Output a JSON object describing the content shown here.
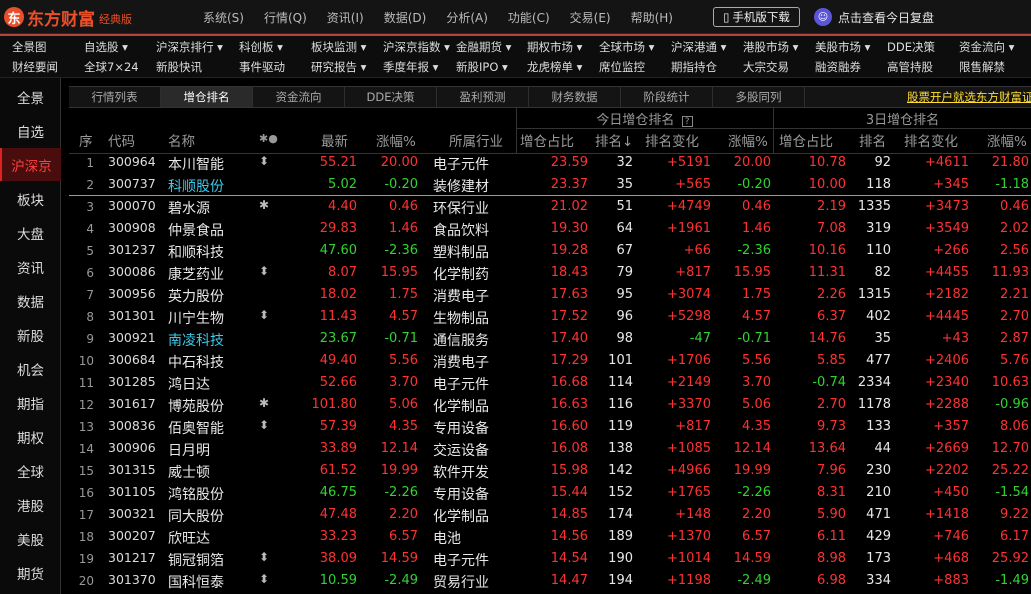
{
  "app": {
    "logo_mark": "东",
    "brand": "东方财富",
    "edition": "经典版",
    "menu": [
      "系统(S)",
      "行情(Q)",
      "资讯(I)",
      "数据(D)",
      "分析(A)",
      "功能(C)",
      "交易(E)",
      "帮助(H)"
    ],
    "mobile_button": "手机版下载",
    "review_link": "点击查看今日复盘"
  },
  "quick_menu": {
    "row1": [
      "全景图",
      "自选股 ▾",
      "沪深京排行 ▾",
      "科创板 ▾",
      "板块监测 ▾",
      "沪深京指数 ▾",
      "金融期货 ▾",
      "期权市场 ▾",
      "全球市场 ▾",
      "沪深港通 ▾",
      "港股市场 ▾",
      "美股市场 ▾",
      "DDE决策",
      "资金流向 ▾"
    ],
    "row2": [
      "财经要闻",
      "全球7×24",
      "新股快讯",
      "事件驱动",
      "研究报告 ▾",
      "季度年报 ▾",
      "新股IPO ▾",
      "龙虎榜单 ▾",
      "席位监控",
      "期指持仓",
      "大宗交易",
      "融资融券",
      "高管持股",
      "限售解禁"
    ]
  },
  "sidebar": [
    "全景",
    "自选",
    "沪深京",
    "板块",
    "大盘",
    "资讯",
    "数据",
    "新股",
    "机会",
    "期指",
    "期权",
    "全球",
    "港股",
    "美股",
    "期货"
  ],
  "sidebar_active": 2,
  "subtabs": [
    "行情列表",
    "增仓排名",
    "资金流向",
    "DDE决策",
    "盈利预测",
    "财务数据",
    "阶段统计",
    "多股同列"
  ],
  "subtab_active": 1,
  "promo": "股票开户就选东方财富证券>>",
  "table": {
    "group_today": "今日增仓排名",
    "group_today_icon": "?",
    "group_3day": "3日增仓排名",
    "headers": [
      "序",
      "代码",
      "名称",
      "✱●",
      "最新",
      "涨幅%",
      "所属行业",
      "增仓占比",
      "排名↓",
      "排名变化",
      "涨幅%",
      "增仓占比",
      "排名",
      "排名变化",
      "涨幅%"
    ],
    "rows": [
      {
        "idx": "1",
        "code": "300964",
        "name": "本川智能",
        "name_color": "white",
        "flag": "⬍",
        "price": "55.21",
        "pct": "20.00",
        "dir": "up",
        "industry": "电子元件",
        "t_ratio": "23.59",
        "t_rank": "32",
        "t_chg": "+5191",
        "t_pct": "20.00",
        "d_ratio": "10.78",
        "d_rank": "92",
        "d_chg": "+4611",
        "d_pct": "21.80",
        "d_pct_dir": "up",
        "d_ratio_dir": "up",
        "t_chg_dir": "up",
        "d_chg_dir": "up"
      },
      {
        "idx": "2",
        "code": "300737",
        "name": "科顺股份",
        "name_color": "cyan",
        "flag": "",
        "price": "5.02",
        "pct": "-0.20",
        "dir": "down",
        "industry": "装修建材",
        "t_ratio": "23.37",
        "t_rank": "35",
        "t_chg": "+565",
        "t_pct": "-0.20",
        "d_ratio": "10.00",
        "d_rank": "118",
        "d_chg": "+345",
        "d_pct": "-1.18",
        "d_pct_dir": "down",
        "d_ratio_dir": "up",
        "t_chg_dir": "up",
        "d_chg_dir": "up"
      },
      {
        "idx": "3",
        "code": "300070",
        "name": "碧水源",
        "name_color": "white",
        "flag": "✱",
        "price": "4.40",
        "pct": "0.46",
        "dir": "up",
        "industry": "环保行业",
        "t_ratio": "21.02",
        "t_rank": "51",
        "t_chg": "+4749",
        "t_pct": "0.46",
        "d_ratio": "2.19",
        "d_rank": "1335",
        "d_chg": "+3473",
        "d_pct": "0.46",
        "d_pct_dir": "up",
        "d_ratio_dir": "up",
        "t_chg_dir": "up",
        "d_chg_dir": "up"
      },
      {
        "idx": "4",
        "code": "300908",
        "name": "仲景食品",
        "name_color": "white",
        "flag": "",
        "price": "29.83",
        "pct": "1.46",
        "dir": "up",
        "industry": "食品饮料",
        "t_ratio": "19.30",
        "t_rank": "64",
        "t_chg": "+1961",
        "t_pct": "1.46",
        "d_ratio": "7.08",
        "d_rank": "319",
        "d_chg": "+3549",
        "d_pct": "2.02",
        "d_pct_dir": "up",
        "d_ratio_dir": "up",
        "t_chg_dir": "up",
        "d_chg_dir": "up"
      },
      {
        "idx": "5",
        "code": "301237",
        "name": "和顺科技",
        "name_color": "white",
        "flag": "",
        "price": "47.60",
        "pct": "-2.36",
        "dir": "down",
        "industry": "塑料制品",
        "t_ratio": "19.28",
        "t_rank": "67",
        "t_chg": "+66",
        "t_pct": "-2.36",
        "d_ratio": "10.16",
        "d_rank": "110",
        "d_chg": "+266",
        "d_pct": "2.56",
        "d_pct_dir": "up",
        "d_ratio_dir": "up",
        "t_chg_dir": "up",
        "d_chg_dir": "up"
      },
      {
        "idx": "6",
        "code": "300086",
        "name": "康芝药业",
        "name_color": "white",
        "flag": "⬍",
        "price": "8.07",
        "pct": "15.95",
        "dir": "up",
        "industry": "化学制药",
        "t_ratio": "18.43",
        "t_rank": "79",
        "t_chg": "+817",
        "t_pct": "15.95",
        "d_ratio": "11.31",
        "d_rank": "82",
        "d_chg": "+4455",
        "d_pct": "11.93",
        "d_pct_dir": "up",
        "d_ratio_dir": "up",
        "t_chg_dir": "up",
        "d_chg_dir": "up"
      },
      {
        "idx": "7",
        "code": "300956",
        "name": "英力股份",
        "name_color": "white",
        "flag": "",
        "price": "18.02",
        "pct": "1.75",
        "dir": "up",
        "industry": "消费电子",
        "t_ratio": "17.63",
        "t_rank": "95",
        "t_chg": "+3074",
        "t_pct": "1.75",
        "d_ratio": "2.26",
        "d_rank": "1315",
        "d_chg": "+2182",
        "d_pct": "2.21",
        "d_pct_dir": "up",
        "d_ratio_dir": "up",
        "t_chg_dir": "up",
        "d_chg_dir": "up"
      },
      {
        "idx": "8",
        "code": "301301",
        "name": "川宁生物",
        "name_color": "white",
        "flag": "⬍",
        "price": "11.43",
        "pct": "4.57",
        "dir": "up",
        "industry": "生物制品",
        "t_ratio": "17.52",
        "t_rank": "96",
        "t_chg": "+5298",
        "t_pct": "4.57",
        "d_ratio": "6.37",
        "d_rank": "402",
        "d_chg": "+4445",
        "d_pct": "2.70",
        "d_pct_dir": "up",
        "d_ratio_dir": "up",
        "t_chg_dir": "up",
        "d_chg_dir": "up"
      },
      {
        "idx": "9",
        "code": "300921",
        "name": "南凌科技",
        "name_color": "cyan",
        "flag": "",
        "price": "23.67",
        "pct": "-0.71",
        "dir": "down",
        "industry": "通信服务",
        "t_ratio": "17.40",
        "t_rank": "98",
        "t_chg": "-47",
        "t_pct": "-0.71",
        "d_ratio": "14.76",
        "d_rank": "35",
        "d_chg": "+43",
        "d_pct": "2.87",
        "d_pct_dir": "up",
        "d_ratio_dir": "up",
        "t_chg_dir": "down",
        "d_chg_dir": "up"
      },
      {
        "idx": "10",
        "code": "300684",
        "name": "中石科技",
        "name_color": "white",
        "flag": "",
        "price": "49.40",
        "pct": "5.56",
        "dir": "up",
        "industry": "消费电子",
        "t_ratio": "17.29",
        "t_rank": "101",
        "t_chg": "+1706",
        "t_pct": "5.56",
        "d_ratio": "5.85",
        "d_rank": "477",
        "d_chg": "+2406",
        "d_pct": "5.76",
        "d_pct_dir": "up",
        "d_ratio_dir": "up",
        "t_chg_dir": "up",
        "d_chg_dir": "up"
      },
      {
        "idx": "11",
        "code": "301285",
        "name": "鸿日达",
        "name_color": "white",
        "flag": "",
        "price": "52.66",
        "pct": "3.70",
        "dir": "up",
        "industry": "电子元件",
        "t_ratio": "16.68",
        "t_rank": "114",
        "t_chg": "+2149",
        "t_pct": "3.70",
        "d_ratio": "-0.74",
        "d_rank": "2334",
        "d_chg": "+2340",
        "d_pct": "10.63",
        "d_pct_dir": "up",
        "d_ratio_dir": "down",
        "t_chg_dir": "up",
        "d_chg_dir": "up"
      },
      {
        "idx": "12",
        "code": "301617",
        "name": "博苑股份",
        "name_color": "white",
        "flag": "✱",
        "price": "101.80",
        "pct": "5.06",
        "dir": "up",
        "industry": "化学制品",
        "t_ratio": "16.63",
        "t_rank": "116",
        "t_chg": "+3370",
        "t_pct": "5.06",
        "d_ratio": "2.70",
        "d_rank": "1178",
        "d_chg": "+2288",
        "d_pct": "-0.96",
        "d_pct_dir": "down",
        "d_ratio_dir": "up",
        "t_chg_dir": "up",
        "d_chg_dir": "up"
      },
      {
        "idx": "13",
        "code": "300836",
        "name": "佰奥智能",
        "name_color": "white",
        "flag": "⬍",
        "price": "57.39",
        "pct": "4.35",
        "dir": "up",
        "industry": "专用设备",
        "t_ratio": "16.60",
        "t_rank": "119",
        "t_chg": "+817",
        "t_pct": "4.35",
        "d_ratio": "9.73",
        "d_rank": "133",
        "d_chg": "+357",
        "d_pct": "8.06",
        "d_pct_dir": "up",
        "d_ratio_dir": "up",
        "t_chg_dir": "up",
        "d_chg_dir": "up"
      },
      {
        "idx": "14",
        "code": "300906",
        "name": "日月明",
        "name_color": "white",
        "flag": "",
        "price": "33.89",
        "pct": "12.14",
        "dir": "up",
        "industry": "交运设备",
        "t_ratio": "16.08",
        "t_rank": "138",
        "t_chg": "+1085",
        "t_pct": "12.14",
        "d_ratio": "13.64",
        "d_rank": "44",
        "d_chg": "+2669",
        "d_pct": "12.70",
        "d_pct_dir": "up",
        "d_ratio_dir": "up",
        "t_chg_dir": "up",
        "d_chg_dir": "up"
      },
      {
        "idx": "15",
        "code": "301315",
        "name": "威士顿",
        "name_color": "white",
        "flag": "",
        "price": "61.52",
        "pct": "19.99",
        "dir": "up",
        "industry": "软件开发",
        "t_ratio": "15.98",
        "t_rank": "142",
        "t_chg": "+4966",
        "t_pct": "19.99",
        "d_ratio": "7.96",
        "d_rank": "230",
        "d_chg": "+2202",
        "d_pct": "25.22",
        "d_pct_dir": "up",
        "d_ratio_dir": "up",
        "t_chg_dir": "up",
        "d_chg_dir": "up"
      },
      {
        "idx": "16",
        "code": "301105",
        "name": "鸿铭股份",
        "name_color": "white",
        "flag": "",
        "price": "46.75",
        "pct": "-2.26",
        "dir": "down",
        "industry": "专用设备",
        "t_ratio": "15.44",
        "t_rank": "152",
        "t_chg": "+1765",
        "t_pct": "-2.26",
        "d_ratio": "8.31",
        "d_rank": "210",
        "d_chg": "+450",
        "d_pct": "-1.54",
        "d_pct_dir": "down",
        "d_ratio_dir": "up",
        "t_chg_dir": "up",
        "d_chg_dir": "up"
      },
      {
        "idx": "17",
        "code": "300321",
        "name": "同大股份",
        "name_color": "white",
        "flag": "",
        "price": "47.48",
        "pct": "2.20",
        "dir": "up",
        "industry": "化学制品",
        "t_ratio": "14.85",
        "t_rank": "174",
        "t_chg": "+148",
        "t_pct": "2.20",
        "d_ratio": "5.90",
        "d_rank": "471",
        "d_chg": "+1418",
        "d_pct": "9.22",
        "d_pct_dir": "up",
        "d_ratio_dir": "up",
        "t_chg_dir": "up",
        "d_chg_dir": "up"
      },
      {
        "idx": "18",
        "code": "300207",
        "name": "欣旺达",
        "name_color": "white",
        "flag": "",
        "price": "33.23",
        "pct": "6.57",
        "dir": "up",
        "industry": "电池",
        "t_ratio": "14.56",
        "t_rank": "189",
        "t_chg": "+1370",
        "t_pct": "6.57",
        "d_ratio": "6.11",
        "d_rank": "429",
        "d_chg": "+746",
        "d_pct": "6.17",
        "d_pct_dir": "up",
        "d_ratio_dir": "up",
        "t_chg_dir": "up",
        "d_chg_dir": "up"
      },
      {
        "idx": "19",
        "code": "301217",
        "name": "铜冠铜箔",
        "name_color": "white",
        "flag": "⬍",
        "price": "38.09",
        "pct": "14.59",
        "dir": "up",
        "industry": "电子元件",
        "t_ratio": "14.54",
        "t_rank": "190",
        "t_chg": "+1014",
        "t_pct": "14.59",
        "d_ratio": "8.98",
        "d_rank": "173",
        "d_chg": "+468",
        "d_pct": "25.92",
        "d_pct_dir": "up",
        "d_ratio_dir": "up",
        "t_chg_dir": "up",
        "d_chg_dir": "up"
      },
      {
        "idx": "20",
        "code": "301370",
        "name": "国科恒泰",
        "name_color": "white",
        "flag": "⬍",
        "price": "10.59",
        "pct": "-2.49",
        "dir": "down",
        "industry": "贸易行业",
        "t_ratio": "14.47",
        "t_rank": "194",
        "t_chg": "+1198",
        "t_pct": "-2.49",
        "d_ratio": "6.98",
        "d_rank": "334",
        "d_chg": "+883",
        "d_pct": "-1.49",
        "d_pct_dir": "down",
        "d_ratio_dir": "up",
        "t_chg_dir": "up",
        "d_chg_dir": "up"
      }
    ]
  },
  "colors": {
    "up": "#ff3232",
    "down": "#32d232",
    "accent": "#e9502a",
    "promo": "#ffdd33"
  }
}
